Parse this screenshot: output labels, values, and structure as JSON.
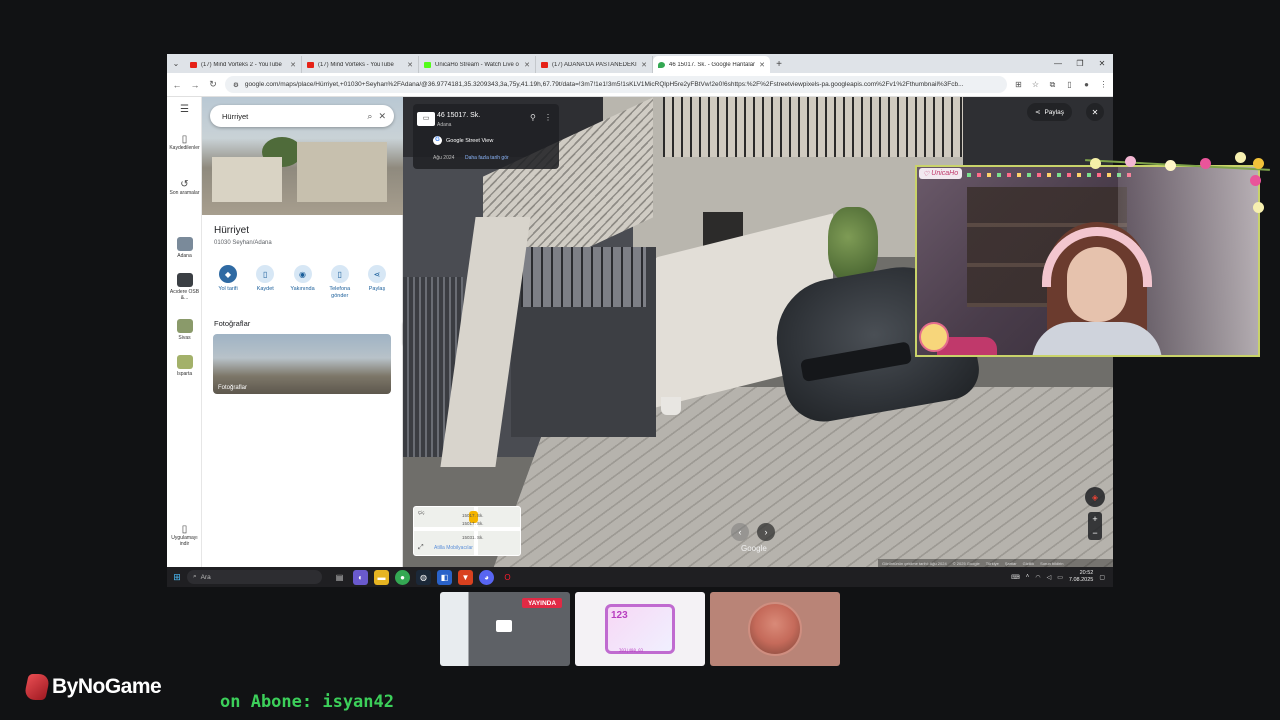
{
  "browser": {
    "tabs": [
      {
        "title": "(17) Mind Vorteks 2 - YouTube",
        "favicon_color": "#e62117"
      },
      {
        "title": "(17) Mind Vorteks - YouTube",
        "favicon_color": "#e62117"
      },
      {
        "title": "UnicaHo Stream - Watch Live o",
        "favicon_color": "#53fc18"
      },
      {
        "title": "(17) ADANA'DA PASTANEDEKİ",
        "favicon_color": "#e62117"
      },
      {
        "title": "46 15017. Sk. - Google Haritalar",
        "favicon_color": "#34a853"
      }
    ],
    "url": "google.com/maps/place/Hürriyet,+01030+Seyhan%2FAdana/@36.9774181,35.3209343,3a,75y,41.19h,67.79t/data=!3m7!1e1!3m5!1sKLV1MicRQlpH5re2yFBtVw!2e0!6shttps:%2F%2Fstreetviewpixels-pa.googleapis.com%2Fv1%2Fthumbnail%3Fcb..."
  },
  "maps": {
    "rail": {
      "saved": "Kaydedilenler",
      "recent": "Son aramalar",
      "history": [
        "Adana",
        "Acıdere OSB &...",
        "Sivas",
        "Isparta"
      ],
      "get_app": "Uygulamayı indir"
    },
    "search": {
      "query": "Hürriyet"
    },
    "place": {
      "name": "Hürriyet",
      "address": "01030 Seyhan/Adana",
      "actions": [
        "Yol tarifi",
        "Kaydet",
        "Yakınında",
        "Telefona gönder",
        "Paylaş"
      ],
      "photos_title": "Fotoğraflar",
      "photos_card_label": "Fotoğraflar"
    },
    "streetview": {
      "street": "46 15017. Sk.",
      "city": "Adana",
      "source": "Google Street View",
      "date": "Ağu 2024",
      "more_dates": "Daha fazla tarih gör",
      "share": "Paylaş",
      "google": "Google",
      "footer": [
        "Görüntünün çekilme tarihi: Ağu 2024",
        "© 2025 Google",
        "Türkiye",
        "Şartlar",
        "Gizlilik",
        "Sorun bildirin"
      ]
    },
    "minimap": {
      "labels": [
        "Çiç",
        "15017. Sk.",
        "15017. Sk.",
        "15031. Sk."
      ],
      "poi": "Atilla Mobilyacılar"
    }
  },
  "taskbar": {
    "search_placeholder": "Ara",
    "time": "20:52",
    "date": "7.08.2025"
  },
  "webcam": {
    "name_tag": "UnicaHo"
  },
  "scenes": {
    "live_badge": "YAYINDA",
    "art_number": "123",
    "art_caption": "203|400_03"
  },
  "brand": "ByNoGame",
  "ticker": "on Abone: isyan42"
}
